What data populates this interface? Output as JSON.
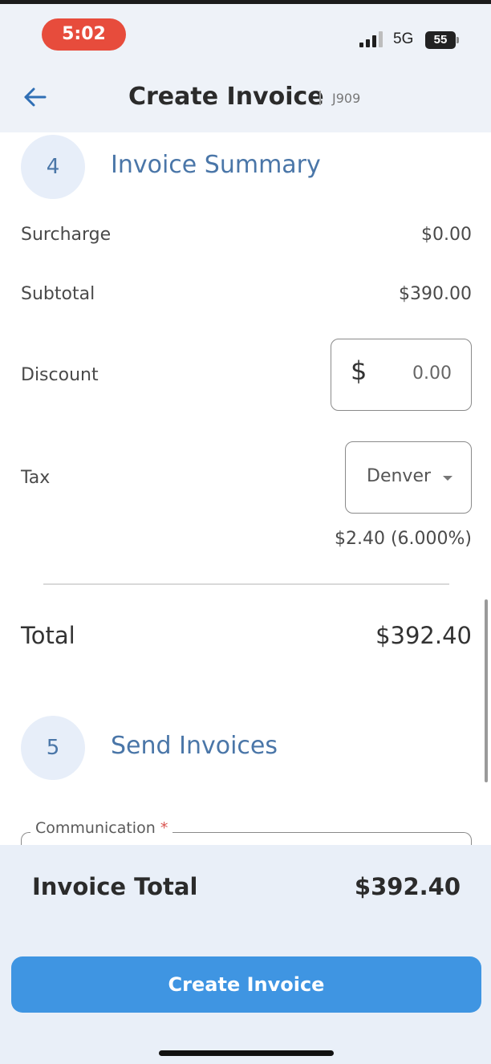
{
  "status_bar": {
    "time": "5:02",
    "network": "5G",
    "battery": "55",
    "time_pill_color": "#e74c3c"
  },
  "header": {
    "title": "Create Invoice",
    "job_id": "J909",
    "back_icon": "back-arrow-icon"
  },
  "invoice_summary": {
    "step_number": "4",
    "title": "Invoice Summary",
    "rows": {
      "surcharge": {
        "label": "Surcharge",
        "value": "$0.00"
      },
      "subtotal": {
        "label": "Subtotal",
        "value": "$390.00"
      }
    },
    "discount": {
      "label": "Discount",
      "currency_symbol": "$",
      "value": "0.00"
    },
    "tax": {
      "label": "Tax",
      "selected": "Denver",
      "amount": "$2.40 (6.000%)"
    },
    "total": {
      "label": "Total",
      "value": "$392.40"
    }
  },
  "send_invoices": {
    "step_number": "5",
    "title": "Send Invoices",
    "communication_label": "Communication",
    "required_marker": "*"
  },
  "footer": {
    "invoice_total_label": "Invoice Total",
    "invoice_total_value": "$392.40",
    "create_button_label": "Create Invoice",
    "button_color": "#3f95e2"
  },
  "accent_color": "#4a76a8"
}
